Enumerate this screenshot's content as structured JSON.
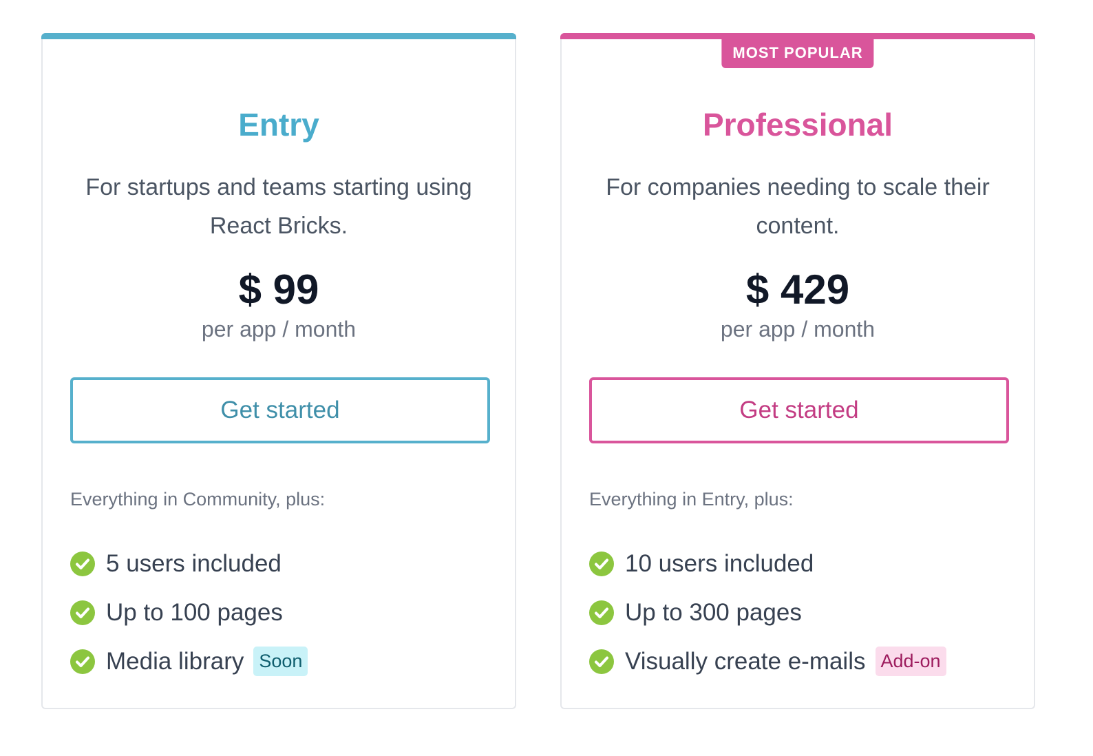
{
  "plans": [
    {
      "name": "Entry",
      "description": "For startups and teams starting using React Bricks.",
      "price": "$ 99",
      "price_unit": "per app / month",
      "cta": "Get started",
      "features_intro": "Everything in Community, plus:",
      "features": [
        {
          "label": "5 users included"
        },
        {
          "label": "Up to 100 pages"
        },
        {
          "label": "Media library",
          "tag": "Soon"
        }
      ]
    },
    {
      "badge": "MOST POPULAR",
      "name": "Professional",
      "description": "For companies needing to scale their content.",
      "price": "$ 429",
      "price_unit": "per app / month",
      "cta": "Get started",
      "features_intro": "Everything in Entry, plus:",
      "features": [
        {
          "label": "10 users included"
        },
        {
          "label": "Up to 300 pages"
        },
        {
          "label": "Visually create e-mails",
          "tag": "Add-on"
        }
      ]
    }
  ],
  "colors": {
    "entry_accent": "#56b0cc",
    "pro_accent": "#d9559b",
    "check_green": "#8cc63f"
  },
  "icons": {
    "feature_check": "check-circle-icon"
  }
}
